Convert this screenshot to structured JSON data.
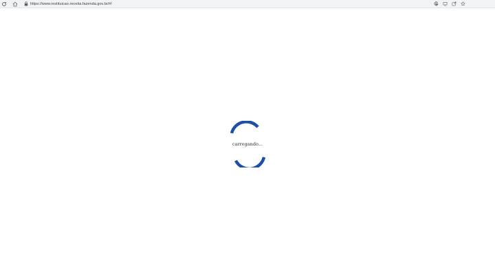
{
  "browser": {
    "url": "https://www.restituicao.receita.fazenda.gov.br/#/",
    "nav_icons": [
      "reload-icon",
      "home-icon"
    ],
    "toolbar_icons": [
      "google-icon",
      "screen-cast-icon",
      "share-icon",
      "bookmark-star-icon"
    ]
  },
  "loader": {
    "text": "carregando...",
    "spinner_color": "#1c4fa8"
  },
  "colors": {
    "background": "#ffffff",
    "browser_bar": "#f1f3f4"
  }
}
